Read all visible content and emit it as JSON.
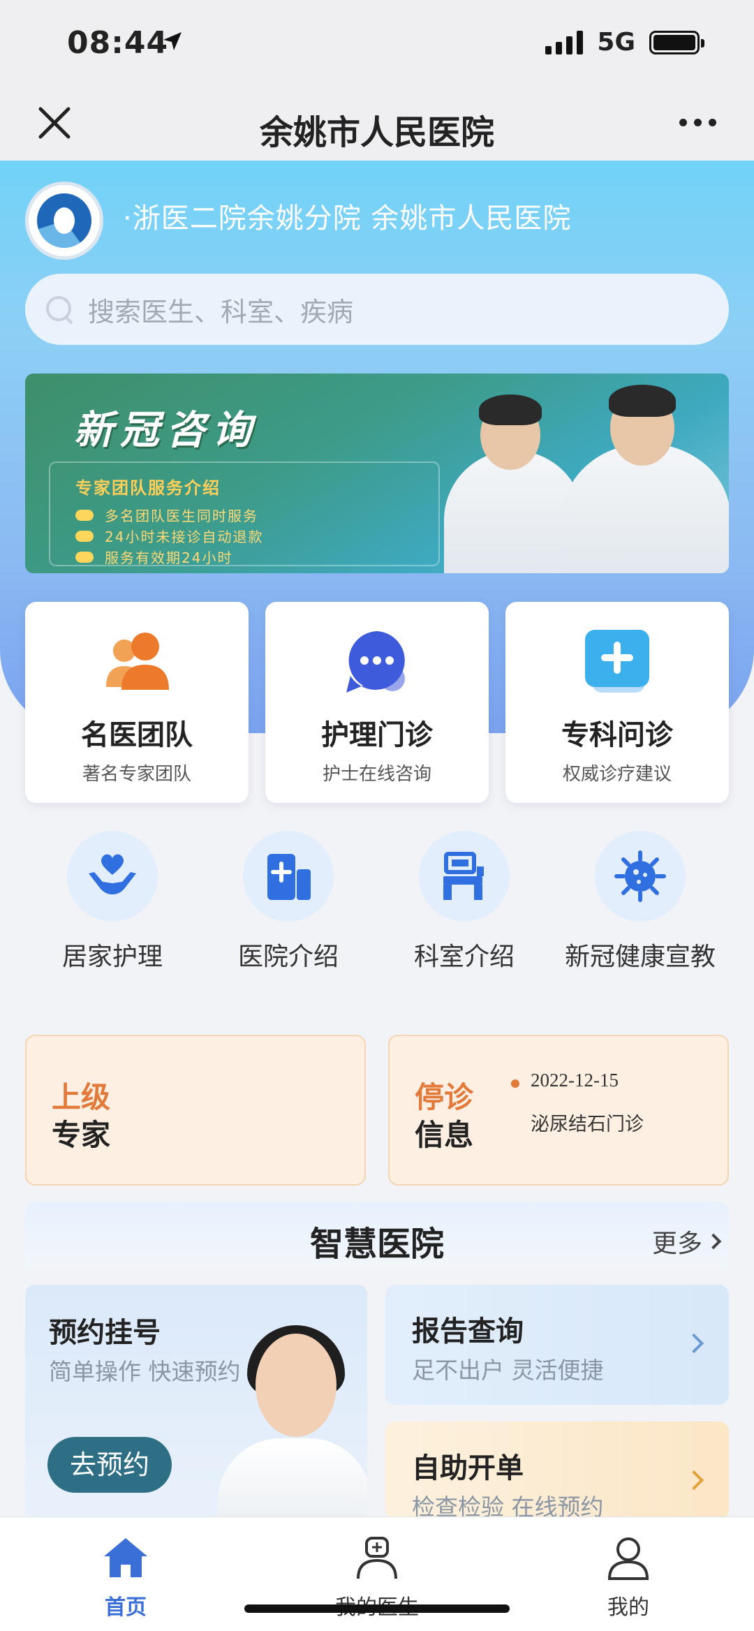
{
  "status_bar": {
    "time": "08:44",
    "network": "5G"
  },
  "nav": {
    "title": "余姚市人民医院"
  },
  "hero": {
    "subtitle": "·浙医二院余姚分院  余姚市人民医院"
  },
  "search": {
    "placeholder": "搜索医生、科室、疾病"
  },
  "banner": {
    "title": "新冠咨询",
    "box_title": "专家团队服务介绍",
    "lines": [
      "多名团队医生同时服务",
      "24小时未接诊自动退款",
      "服务有效期24小时"
    ]
  },
  "service_cards": [
    {
      "title": "名医团队",
      "subtitle": "著名专家团队",
      "icon": "people-icon"
    },
    {
      "title": "护理门诊",
      "subtitle": "护士在线咨询",
      "icon": "chat-bubble-icon"
    },
    {
      "title": "专科问诊",
      "subtitle": "权威诊疗建议",
      "icon": "medical-box-icon"
    }
  ],
  "quick_links": [
    {
      "label": "居家护理",
      "icon": "heart-hands-icon"
    },
    {
      "label": "医院介绍",
      "icon": "hospital-building-icon"
    },
    {
      "label": "科室介绍",
      "icon": "department-icon"
    },
    {
      "label": "新冠健康宣教",
      "icon": "virus-icon"
    }
  ],
  "expert_card": {
    "line1": "上级",
    "line2": "专家"
  },
  "stop_card": {
    "line1": "停诊",
    "line2": "信息",
    "date": "2022-12-15",
    "dept": "泌尿结石门诊"
  },
  "smart_hospital": {
    "title": "智慧医院",
    "more": "更多"
  },
  "appointment": {
    "title": "预约挂号",
    "subtitle": "简单操作 快速预约",
    "button": "去预约"
  },
  "report": {
    "title": "报告查询",
    "subtitle": "足不出户 灵活便捷"
  },
  "self_order": {
    "title": "自助开单",
    "subtitle": "检查检验 在线预约"
  },
  "tabbar": [
    {
      "label": "首页",
      "icon": "home-icon",
      "active": true
    },
    {
      "label": "我的医生",
      "icon": "doctor-icon",
      "active": false
    },
    {
      "label": "我的",
      "icon": "user-icon",
      "active": false
    }
  ],
  "colors": {
    "accent": "#3a6fd8",
    "hero_bg": "#8bb9f2",
    "orange": "#e27a3c"
  }
}
